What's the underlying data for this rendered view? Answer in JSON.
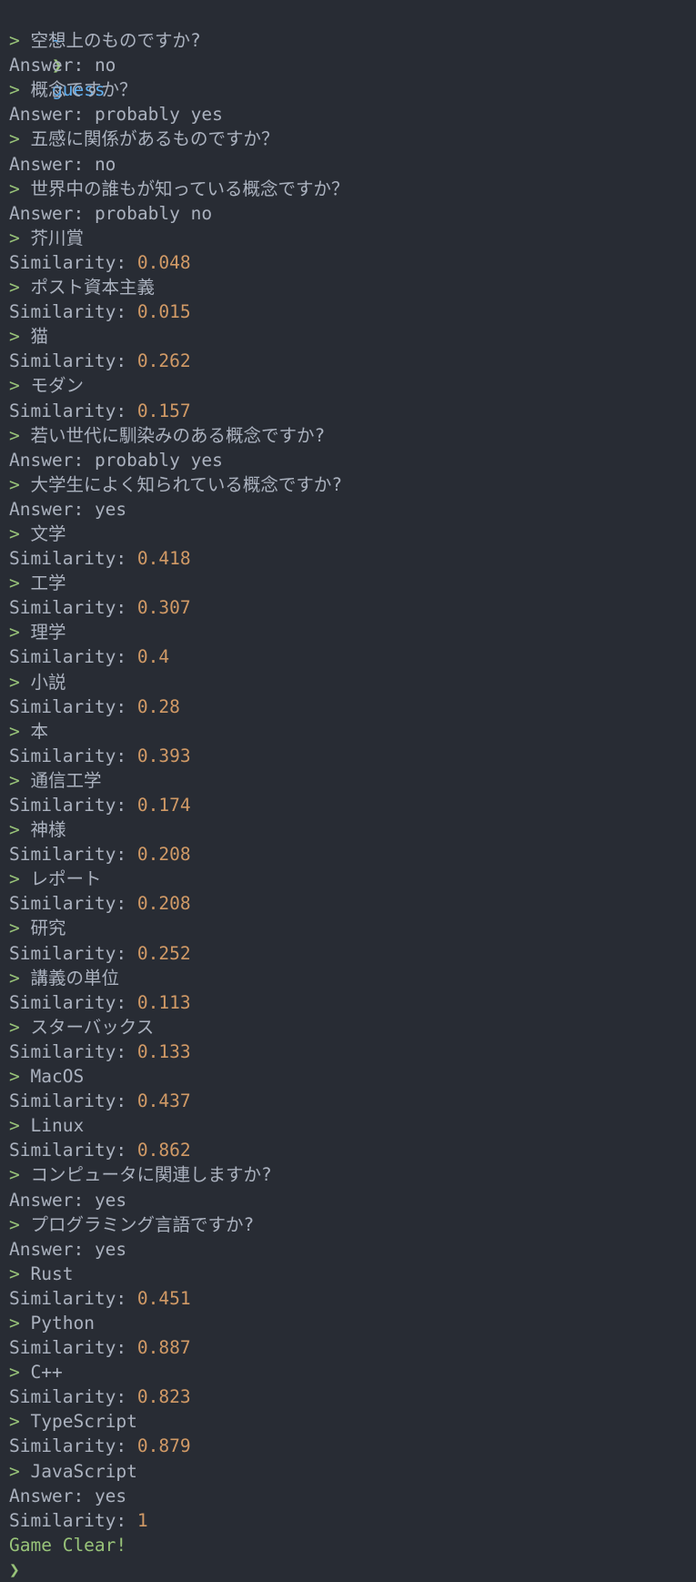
{
  "terminal": {
    "prompt_dir": "~",
    "prompt_symbol": "❯",
    "command": "guess",
    "input_marker": ">",
    "answer_label": "Answer:",
    "similarity_label": "Similarity:",
    "colors": {
      "background": "#282c34",
      "text": "#abb2bf",
      "green": "#98c379",
      "blue": "#61afef",
      "orange": "#d19a66"
    },
    "entries": [
      {
        "type": "answer",
        "input": "空想上のものですか?",
        "value": "no"
      },
      {
        "type": "answer",
        "input": "概念ですか？",
        "value": "probably yes"
      },
      {
        "type": "answer",
        "input": "五感に関係があるものですか？",
        "value": "no"
      },
      {
        "type": "answer",
        "input": "世界中の誰もが知っている概念ですか？",
        "value": "probably no"
      },
      {
        "type": "similarity",
        "input": "芥川賞",
        "value": "0.048"
      },
      {
        "type": "similarity",
        "input": "ポスト資本主義",
        "value": "0.015"
      },
      {
        "type": "similarity",
        "input": "猫",
        "value": "0.262"
      },
      {
        "type": "similarity",
        "input": "モダン",
        "value": "0.157"
      },
      {
        "type": "answer",
        "input": "若い世代に馴染みのある概念ですか?",
        "value": "probably yes"
      },
      {
        "type": "answer",
        "input": "大学生によく知られている概念ですか?",
        "value": "yes"
      },
      {
        "type": "similarity",
        "input": "文学",
        "value": "0.418"
      },
      {
        "type": "similarity",
        "input": "工学",
        "value": "0.307"
      },
      {
        "type": "similarity",
        "input": "理学",
        "value": "0.4"
      },
      {
        "type": "similarity",
        "input": "小説",
        "value": "0.28"
      },
      {
        "type": "similarity",
        "input": "本",
        "value": "0.393"
      },
      {
        "type": "similarity",
        "input": "通信工学",
        "value": "0.174"
      },
      {
        "type": "similarity",
        "input": "神様",
        "value": "0.208"
      },
      {
        "type": "similarity",
        "input": "レポート",
        "value": "0.208"
      },
      {
        "type": "similarity",
        "input": "研究",
        "value": "0.252"
      },
      {
        "type": "similarity",
        "input": "講義の単位",
        "value": "0.113"
      },
      {
        "type": "similarity",
        "input": "スターバックス",
        "value": "0.133"
      },
      {
        "type": "similarity",
        "input": "MacOS",
        "value": "0.437"
      },
      {
        "type": "similarity",
        "input": "Linux",
        "value": "0.862"
      },
      {
        "type": "answer",
        "input": "コンピュータに関連しますか?",
        "value": "yes"
      },
      {
        "type": "answer",
        "input": "プログラミング言語ですか?",
        "value": "yes"
      },
      {
        "type": "similarity",
        "input": "Rust",
        "value": "0.451"
      },
      {
        "type": "similarity",
        "input": "Python",
        "value": "0.887"
      },
      {
        "type": "similarity",
        "input": "C++",
        "value": "0.823"
      },
      {
        "type": "similarity",
        "input": "TypeScript",
        "value": "0.879"
      }
    ],
    "final": {
      "input": "JavaScript",
      "answer": "yes",
      "similarity": "1",
      "result": "Game Clear!"
    },
    "end_prompt_symbol": "❯"
  }
}
